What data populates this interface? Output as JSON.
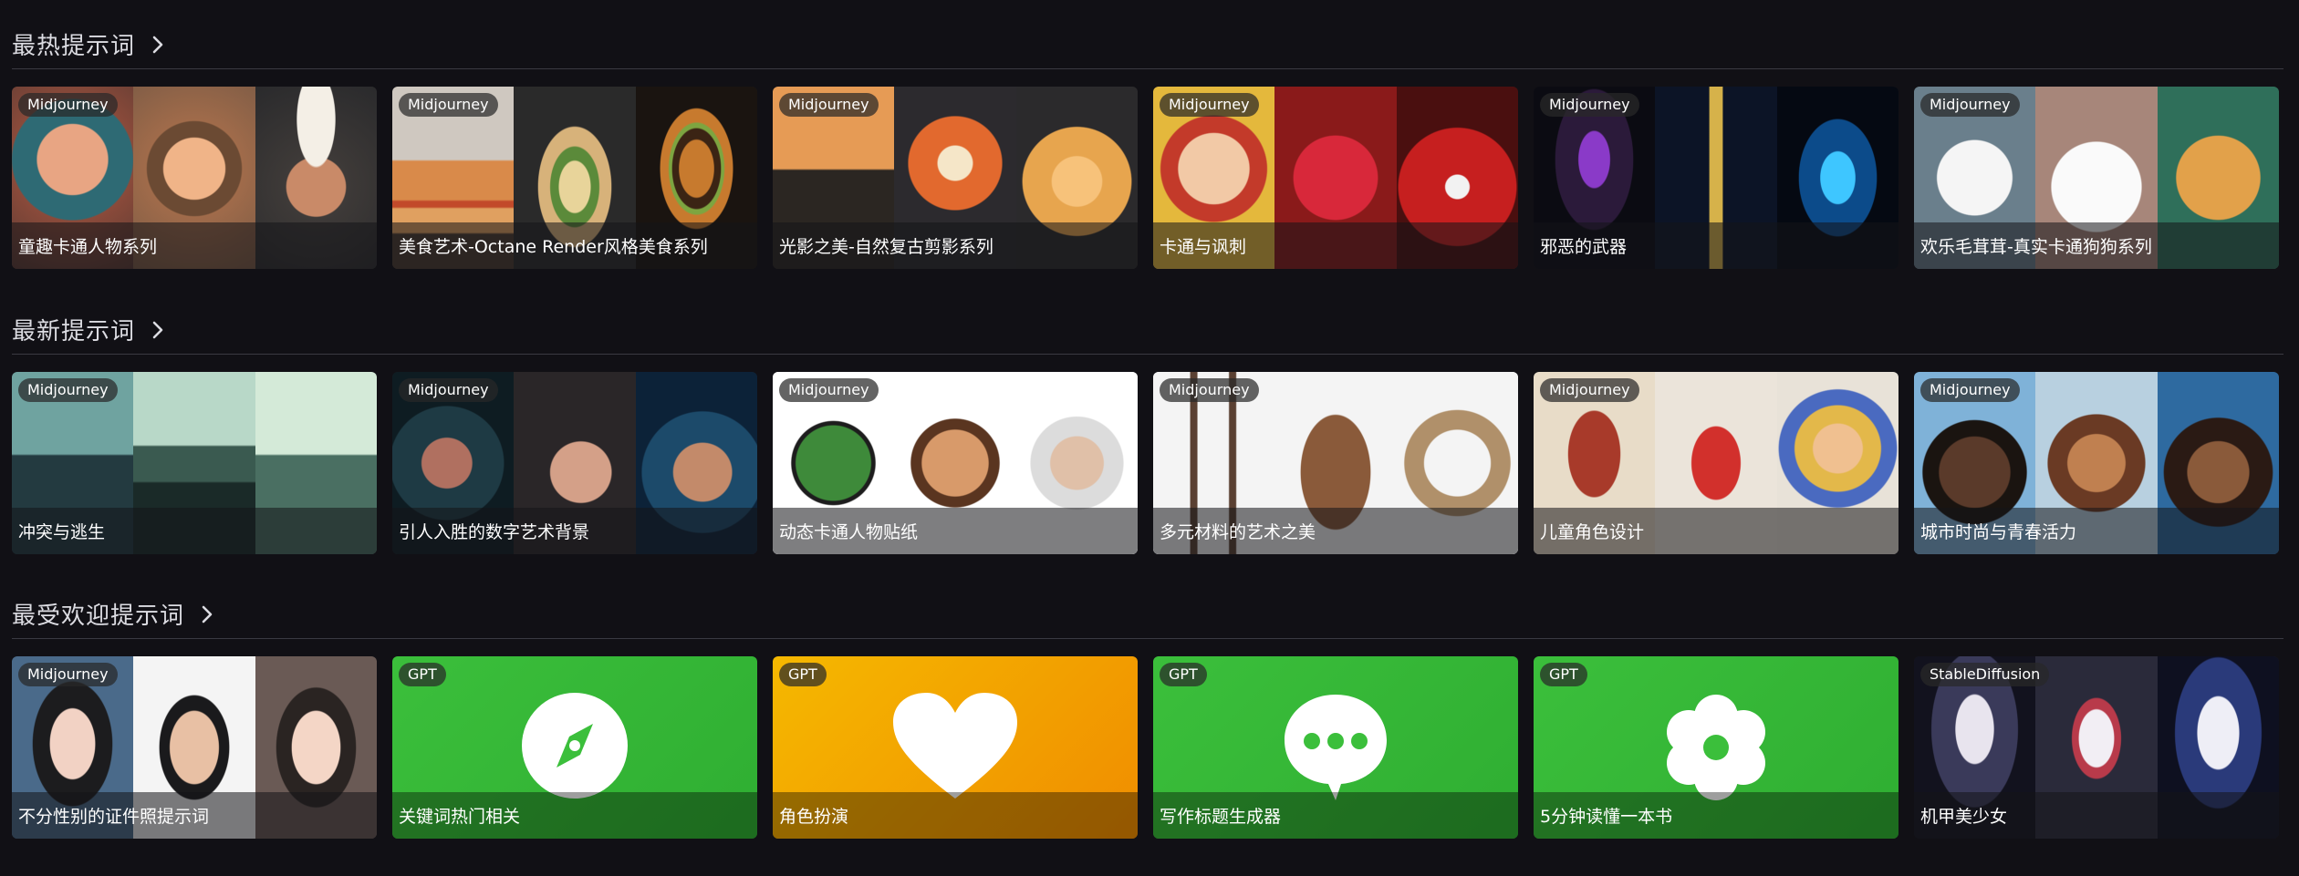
{
  "sections": [
    {
      "title": "最热提示词",
      "cards": [
        {
          "badge": "Midjourney",
          "caption": "童趣卡通人物系列"
        },
        {
          "badge": "Midjourney",
          "caption": "美食艺术-Octane Render风格美食系列"
        },
        {
          "badge": "Midjourney",
          "caption": "光影之美-自然复古剪影系列"
        },
        {
          "badge": "Midjourney",
          "caption": "卡通与讽刺"
        },
        {
          "badge": "Midjourney",
          "caption": "邪恶的武器"
        },
        {
          "badge": "Midjourney",
          "caption": "欢乐毛茸茸-真实卡通狗狗系列"
        }
      ]
    },
    {
      "title": "最新提示词",
      "cards": [
        {
          "badge": "Midjourney",
          "caption": "冲突与逃生"
        },
        {
          "badge": "Midjourney",
          "caption": "引人入胜的数字艺术背景"
        },
        {
          "badge": "Midjourney",
          "caption": "动态卡通人物贴纸"
        },
        {
          "badge": "Midjourney",
          "caption": "多元材料的艺术之美"
        },
        {
          "badge": "Midjourney",
          "caption": "儿童角色设计"
        },
        {
          "badge": "Midjourney",
          "caption": "城市时尚与青春活力"
        }
      ]
    },
    {
      "title": "最受欢迎提示词",
      "cards": [
        {
          "badge": "Midjourney",
          "caption": "不分性别的证件照提示词"
        },
        {
          "badge": "GPT",
          "caption": "关键词热门相关",
          "icon": "compass-icon",
          "bg": "#3bbf3b"
        },
        {
          "badge": "GPT",
          "caption": "角色扮演",
          "icon": "heart-icon",
          "bg": "#f5b800"
        },
        {
          "badge": "GPT",
          "caption": "写作标题生成器",
          "icon": "chat-bubble-icon",
          "bg": "#3bbf3b"
        },
        {
          "badge": "GPT",
          "caption": "5分钟读懂一本书",
          "icon": "flower-gear-icon",
          "bg": "#3bbf3b"
        },
        {
          "badge": "StableDiffusion",
          "caption": "机甲美少女"
        }
      ]
    }
  ]
}
